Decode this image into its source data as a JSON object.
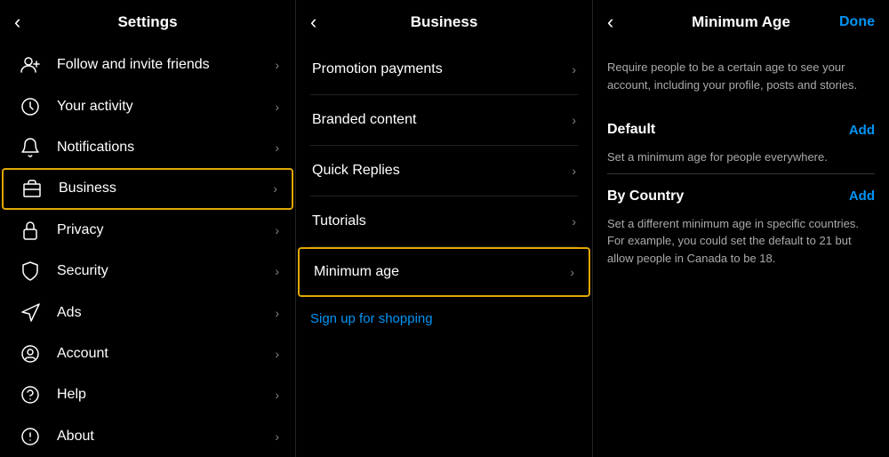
{
  "panels": {
    "left": {
      "header": {
        "title": "Settings"
      },
      "items": [
        {
          "id": "follow",
          "label": "Follow and invite friends",
          "icon": "person-add"
        },
        {
          "id": "activity",
          "label": "Your activity",
          "icon": "clock"
        },
        {
          "id": "notifications",
          "label": "Notifications",
          "icon": "bell"
        },
        {
          "id": "business",
          "label": "Business",
          "icon": "business",
          "highlighted": true
        },
        {
          "id": "privacy",
          "label": "Privacy",
          "icon": "lock"
        },
        {
          "id": "security",
          "label": "Security",
          "icon": "shield"
        },
        {
          "id": "ads",
          "label": "Ads",
          "icon": "megaphone"
        },
        {
          "id": "account",
          "label": "Account",
          "icon": "person-circle"
        },
        {
          "id": "help",
          "label": "Help",
          "icon": "question-circle"
        },
        {
          "id": "about",
          "label": "About",
          "icon": "info-circle"
        }
      ]
    },
    "middle": {
      "header": {
        "title": "Business"
      },
      "items": [
        {
          "id": "promotion",
          "label": "Promotion payments",
          "icon": false
        },
        {
          "id": "branded",
          "label": "Branded content",
          "icon": false
        },
        {
          "id": "quickreplies",
          "label": "Quick Replies",
          "icon": false
        },
        {
          "id": "tutorials",
          "label": "Tutorials",
          "icon": false
        },
        {
          "id": "minage",
          "label": "Minimum age",
          "icon": false,
          "highlighted": true
        }
      ],
      "link": "Sign up for shopping"
    },
    "right": {
      "header": {
        "title": "Minimum Age",
        "action": "Done"
      },
      "description": "Require people to be a certain age to see your account, including your profile, posts and stories.",
      "sections": [
        {
          "id": "default",
          "title": "Default",
          "action": "Add",
          "description": "Set a minimum age for people everywhere."
        },
        {
          "id": "by-country",
          "title": "By Country",
          "action": "Add",
          "description": "Set a different minimum age in specific countries. For example, you could set the default to 21 but allow people in Canada to be 18."
        }
      ]
    }
  },
  "icons": {
    "back": "‹",
    "chevron": "›",
    "done": "Done"
  },
  "colors": {
    "accent": "#0095f6",
    "highlight": "#e0a800",
    "text": "#ffffff",
    "muted": "#aaaaaa",
    "bg": "#000000",
    "divider": "#333333"
  }
}
